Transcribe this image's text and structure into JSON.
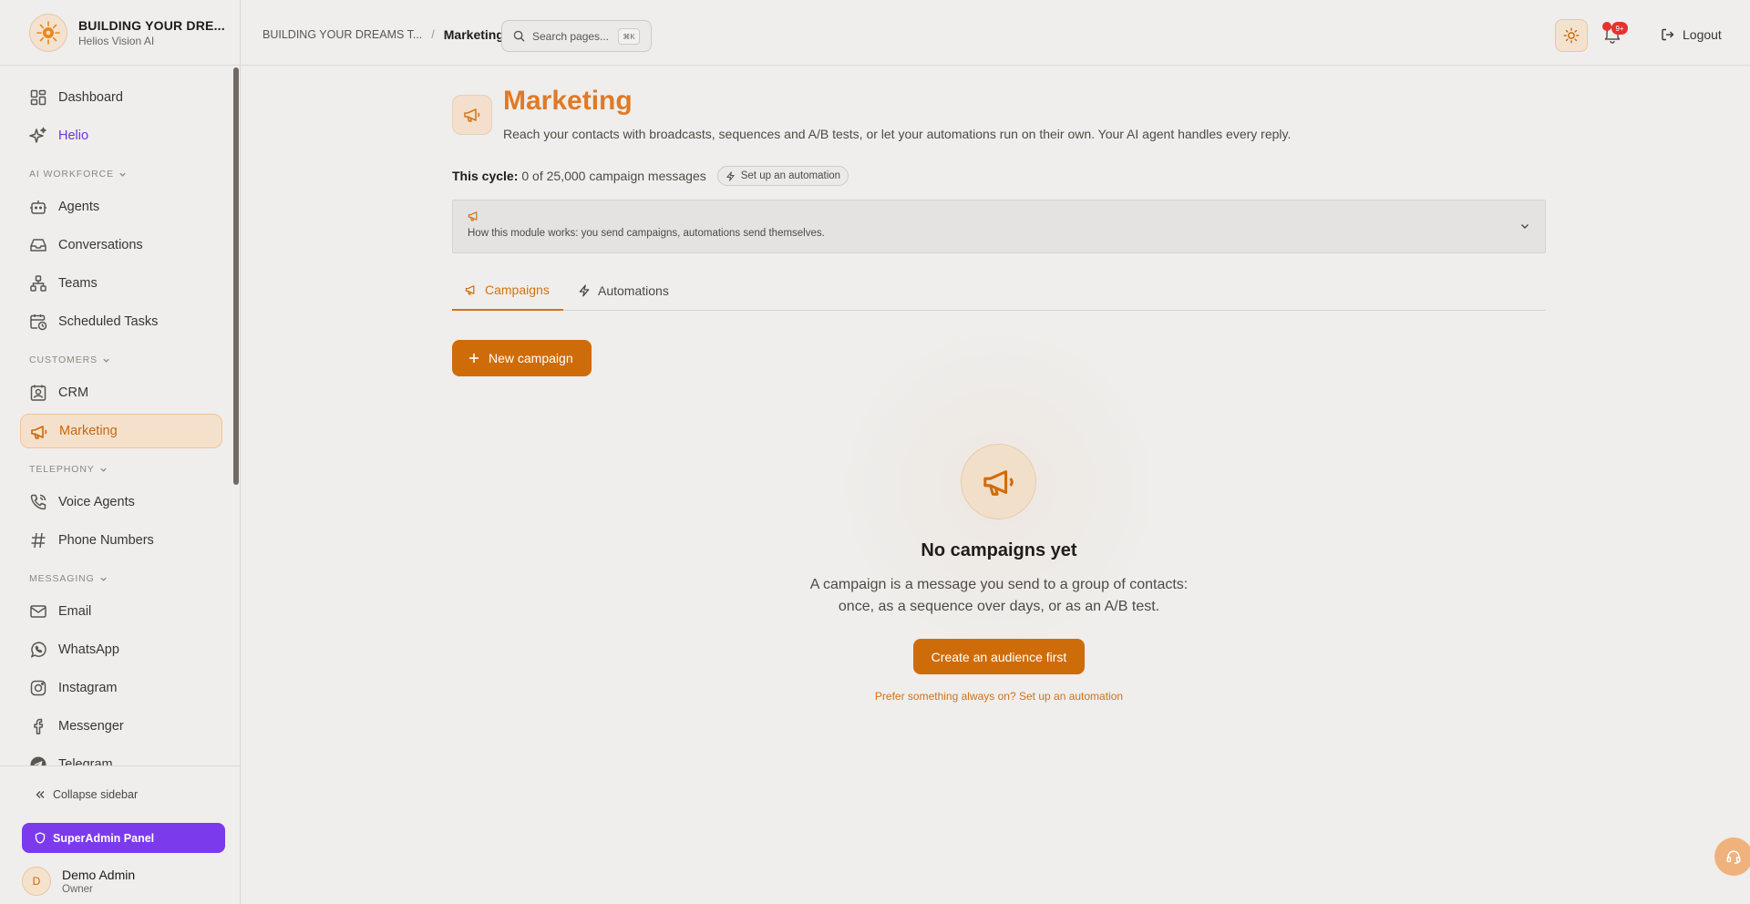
{
  "brand": {
    "name": "BUILDING YOUR DRE...",
    "subtitle": "Helios Vision AI"
  },
  "sidebar": {
    "top_items": [
      {
        "label": "Dashboard",
        "icon": "dashboard-icon"
      },
      {
        "label": "Helio",
        "icon": "sparkles-icon"
      }
    ],
    "sections": [
      {
        "label": "AI WORKFORCE",
        "items": [
          {
            "label": "Agents",
            "icon": "bot-icon"
          },
          {
            "label": "Conversations",
            "icon": "inbox-icon"
          },
          {
            "label": "Teams",
            "icon": "teams-icon"
          },
          {
            "label": "Scheduled Tasks",
            "icon": "calendar-clock-icon"
          }
        ]
      },
      {
        "label": "CUSTOMERS",
        "items": [
          {
            "label": "CRM",
            "icon": "contact-icon"
          },
          {
            "label": "Marketing",
            "icon": "megaphone-icon",
            "active": true
          }
        ]
      },
      {
        "label": "TELEPHONY",
        "items": [
          {
            "label": "Voice Agents",
            "icon": "phone-call-icon"
          },
          {
            "label": "Phone Numbers",
            "icon": "hash-icon"
          }
        ]
      },
      {
        "label": "MESSAGING",
        "items": [
          {
            "label": "Email",
            "icon": "mail-icon"
          },
          {
            "label": "WhatsApp",
            "icon": "whatsapp-icon"
          },
          {
            "label": "Instagram",
            "icon": "instagram-icon"
          },
          {
            "label": "Messenger",
            "icon": "facebook-icon"
          },
          {
            "label": "Telegram",
            "icon": "telegram-icon"
          }
        ]
      }
    ],
    "collapse_label": "Collapse sidebar",
    "superadmin_label": "SuperAdmin Panel",
    "user": {
      "initial": "D",
      "name": "Demo Admin",
      "role": "Owner"
    }
  },
  "topbar": {
    "breadcrumb_parent": "BUILDING YOUR DREAMS T...",
    "breadcrumb_sep": "/",
    "breadcrumb_current": "Marketing",
    "search_placeholder": "Search pages...",
    "search_shortcut": "⌘K",
    "notifications_badge": "9+",
    "logout_label": "Logout"
  },
  "page": {
    "title": "Marketing",
    "subtitle": "Reach your contacts with broadcasts, sequences and A/B tests, or let your automations run on their own. Your AI agent handles every reply.",
    "cycle_label": "This cycle:",
    "cycle_value": "0 of 25,000 campaign messages",
    "cycle_chip": "Set up an automation",
    "info_text": "How this module works: you send campaigns, automations send themselves.",
    "tabs": [
      {
        "label": "Campaigns",
        "active": true
      },
      {
        "label": "Automations",
        "active": false
      }
    ],
    "new_campaign_label": "New campaign",
    "empty": {
      "title": "No campaigns yet",
      "description_line1": "A campaign is a message you send to a group of contacts:",
      "description_line2": "once, as a sequence over days, or as an A/B test.",
      "cta_label": "Create an audience first",
      "alt_link": "Prefer something always on? Set up an automation"
    }
  },
  "colors": {
    "accent": "#cf6c0a",
    "title_accent": "#e07a26",
    "superadmin": "#7c3aed",
    "notification": "#e5322d",
    "helio": "#6d37d6"
  }
}
